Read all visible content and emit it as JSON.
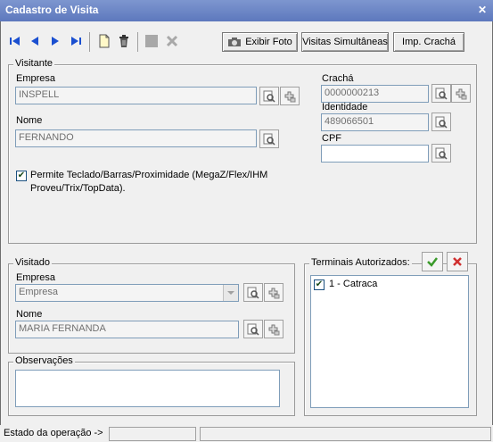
{
  "window": {
    "title": "Cadastro de Visita",
    "close_glyph": "✕"
  },
  "toolbar": {
    "icons": [
      "first-record-icon",
      "prev-record-icon",
      "next-record-icon",
      "last-record-icon",
      "new-document-icon",
      "trash-icon",
      "save-icon",
      "cancel-icon"
    ],
    "exibir_foto": "Exibir Foto",
    "visitas_simultaneas": "Visitas Simultâneas",
    "imp_cracha": "Imp. Crachá"
  },
  "visitante": {
    "legend": "Visitante",
    "empresa_label": "Empresa",
    "empresa_value": "INSPELL",
    "nome_label": "Nome",
    "nome_value": "FERNANDO",
    "cracha_label": "Crachá",
    "cracha_value": "0000000213",
    "identidade_label": "Identidade",
    "identidade_value": "489066501",
    "cpf_label": "CPF",
    "cpf_value": "",
    "permite_line1": "Permite Teclado/Barras/Proximidade (MegaZ/Flex/IHM",
    "permite_line2": "Proveu/Trix/TopData).",
    "permite_checked": true
  },
  "visitado": {
    "legend": "Visitado",
    "empresa_label": "Empresa",
    "empresa_value": "Empresa",
    "nome_label": "Nome",
    "nome_value": "MARIA FERNANDA"
  },
  "observacoes": {
    "legend": "Observações",
    "value": ""
  },
  "terminais": {
    "legend": "Terminais Autorizados:",
    "items": [
      {
        "label": "1 - Catraca",
        "checked": true
      }
    ]
  },
  "status": {
    "label": "Estado da operação ->",
    "panel2": "",
    "panel3": ""
  },
  "colors": {
    "title_bar": "#5d78bd",
    "accent_green": "#3a9a2a",
    "accent_red": "#d03030"
  }
}
